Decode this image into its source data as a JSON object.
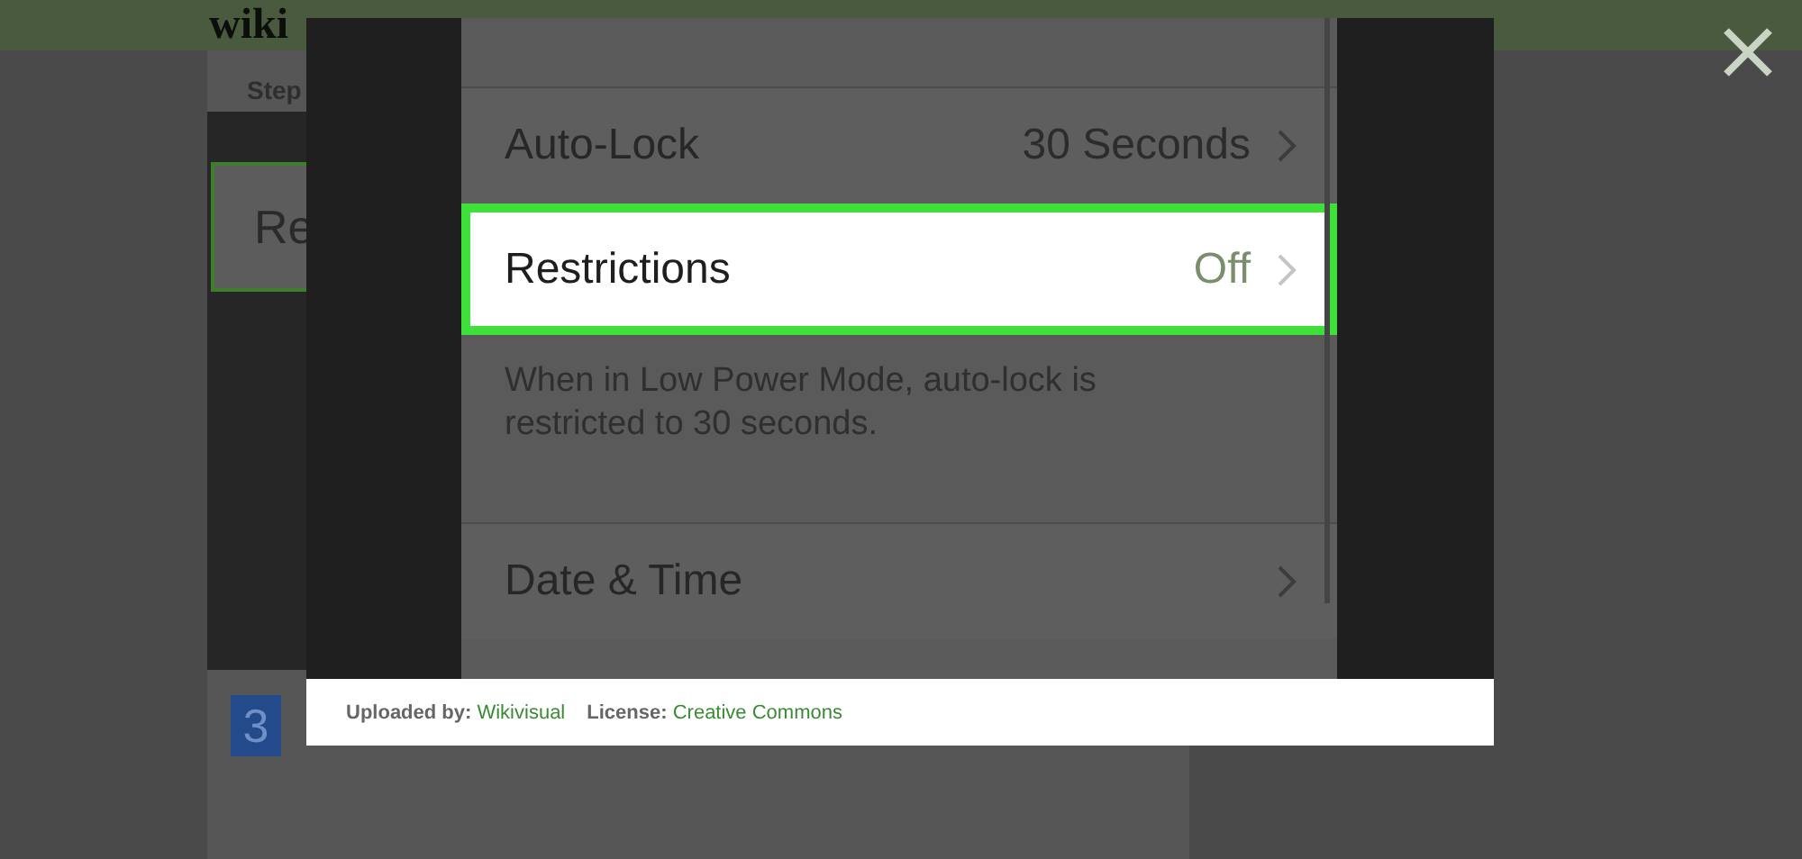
{
  "page": {
    "logo": "wiki",
    "step_label": "Step",
    "heading_fragment": "Re",
    "step_number": "3"
  },
  "lightbox": {
    "image": {
      "rows": [
        {
          "kind": "row",
          "label": "Auto-Lock",
          "value": "30 Seconds",
          "selected": false
        },
        {
          "kind": "row",
          "label": "Restrictions",
          "value": "Off",
          "selected": true
        },
        {
          "kind": "note",
          "text": "When in Low Power Mode, auto-lock is restricted to 30 seconds."
        },
        {
          "kind": "row",
          "label": "Date & Time",
          "selected": false
        }
      ]
    },
    "caption": {
      "uploaded_label": "Uploaded by:",
      "uploader": "Wikivisual",
      "license_label": "License:",
      "license": "Creative Commons"
    }
  }
}
